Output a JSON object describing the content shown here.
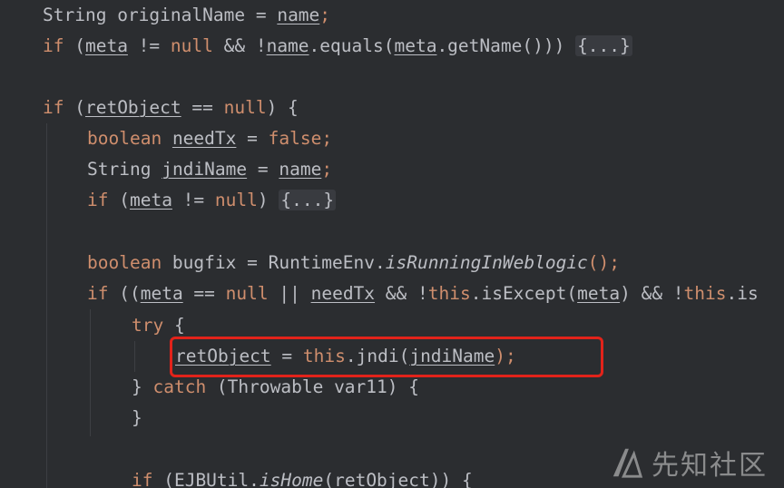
{
  "editor": {
    "colors": {
      "background": "#2b2d30",
      "keyword": "#cf8e6d",
      "text": "#bcbec4",
      "highlight": "#e2231a"
    },
    "lines": {
      "l1": {
        "type": "String",
        "var": "originalName",
        "eq": " = ",
        "val": "name",
        "end": ";"
      },
      "l2": {
        "kw": "if",
        "a": " (",
        "meta": "meta",
        "op": " != ",
        "null": "null",
        "and": " && !",
        "name": "name",
        "equals": ".equals(",
        "meta2": "meta",
        "getName": ".getName())) ",
        "fold": "{...}"
      },
      "l3": {
        "kw": "if",
        "a": " (",
        "ret": "retObject",
        "op": " == ",
        "null": "null",
        "end": ") {"
      },
      "l4": {
        "kw": "boolean",
        "sp": " ",
        "var": "needTx",
        "eq": " = ",
        "val": "false",
        "end": ";"
      },
      "l5": {
        "type": "String",
        "sp": " ",
        "var": "jndiName",
        "eq": " = ",
        "val": "name",
        "end": ";"
      },
      "l6": {
        "kw": "if",
        "a": " (",
        "meta": "meta",
        "op": " != ",
        "null": "null",
        "end": ") ",
        "fold": "{...}"
      },
      "l7": {
        "kw": "boolean",
        "rest": " bugfix = RuntimeEnv.",
        "method": "isRunningInWeblogic",
        "end": "();"
      },
      "l8": {
        "kw": "if",
        "a": " ((",
        "meta": "meta",
        "op": " == ",
        "null": "null",
        "or": " || ",
        "needTx": "needTx",
        "and": " && !",
        "this": "this",
        "except": ".isExcept(",
        "meta2": "meta",
        "and2": ") && !",
        "this2": "this",
        "tail": ".is"
      },
      "l9": {
        "kw": "try",
        "end": " {"
      },
      "l10": {
        "ret": "retObject",
        "eq": " = ",
        "this": "this",
        "jndi": ".jndi(",
        "arg": "jndiName",
        "end": ");"
      },
      "l11": {
        "brace": "} ",
        "kw": "catch",
        "rest": " (Throwable var11) {"
      },
      "l12": {
        "brace": "}"
      },
      "l13": {
        "kw": "if",
        "a": " (EJBUtil.",
        "method": "isHome",
        "b": "(",
        "ret": "retObject",
        "end": ")) {"
      }
    }
  },
  "watermark": {
    "icon": "xianzhi-logo-icon",
    "text": "先知社区"
  }
}
